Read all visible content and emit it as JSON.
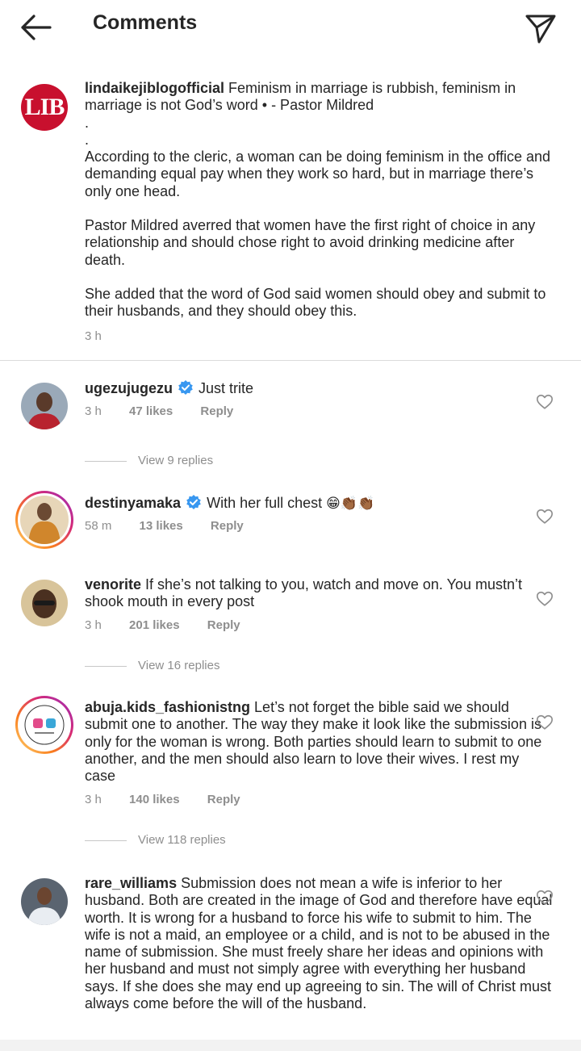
{
  "header": {
    "title": "Comments",
    "back_icon": "arrow-left-icon",
    "share_icon": "send-icon"
  },
  "caption": {
    "username": "lindaikejiblogofficial",
    "avatar_text": "LIB",
    "line1": " Feminism in marriage is rubbish, feminism in marriage is not God’s word • - Pastor Mildred",
    "dot1": ".",
    "dot2": ".",
    "para1": "According to the cleric, a woman can be doing feminism in the office and demanding equal pay when they work so hard, but in marriage there’s only one head.",
    "para2": "Pastor Mildred averred that women have the first right of choice in any relationship and should chose right to avoid drinking medicine after death.",
    "para3": "She added that the word of God said women should obey and submit to their husbands, and they should obey this.",
    "time": "3 h"
  },
  "comments": [
    {
      "username": "ugezujugezu",
      "verified": true,
      "text": "Just trite",
      "time": "3 h",
      "likes": "47 likes",
      "reply": "Reply",
      "view_replies": "View 9 replies"
    },
    {
      "username": "destinyamaka",
      "verified": true,
      "text": "With her full chest ",
      "emoji": "😁👏🏾👏🏾",
      "time": "58 m",
      "likes": "13 likes",
      "reply": "Reply"
    },
    {
      "username": "venorite",
      "verified": false,
      "text": " If she’s not talking to you, watch and move on. You mustn’t shook mouth in every post",
      "time": "3 h",
      "likes": "201 likes",
      "reply": "Reply",
      "view_replies": "View 16 replies"
    },
    {
      "username": "abuja.kids_fashionistng",
      "verified": false,
      "text": " Let’s not forget the bible said we should submit one to another. The way they make it look like the submission is only for the woman is wrong. Both parties should learn to submit to one another, and the men should also learn to love their wives. I rest my case",
      "time": "3 h",
      "likes": "140 likes",
      "reply": "Reply",
      "view_replies": "View 118 replies"
    },
    {
      "username": "rare_williams",
      "verified": false,
      "text": " Submission does not mean a wife is inferior to her husband. Both are created in the image of God and therefore have equal worth. It is wrong for a husband to force his wife to submit to him. The wife is not a maid, an employee or a child, and is not to be abused in the name of submission. She must freely share her ideas and opinions with her husband and must not simply agree with everything her husband says. If she does she may end up agreeing to sin. The will of Christ must always come before the will of the husband."
    }
  ],
  "colors": {
    "text": "#262626",
    "muted": "#8e8e8e",
    "verified": "#3897f0",
    "brand_red": "#c8102e"
  }
}
